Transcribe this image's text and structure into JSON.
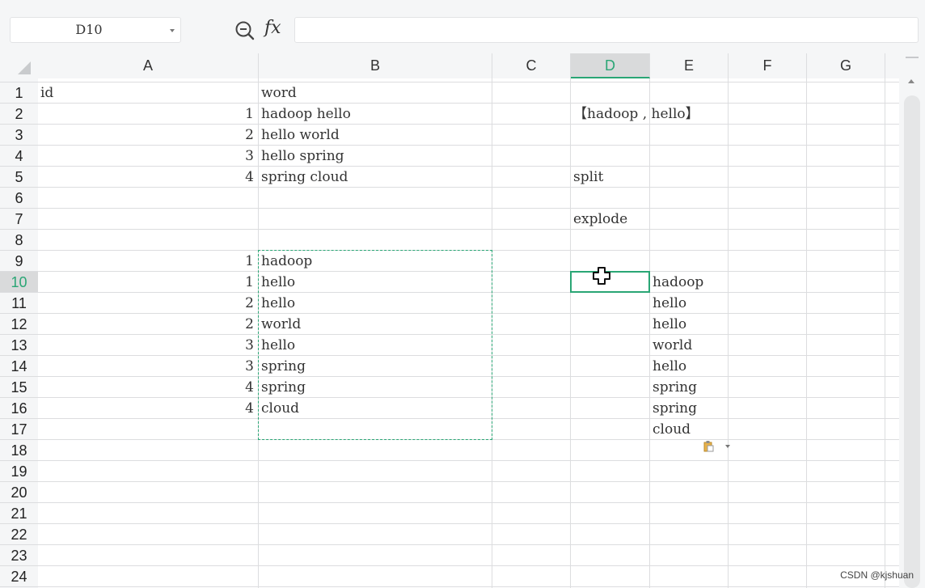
{
  "toolbar": {
    "name_box": "D10",
    "zoom_icon": "zoom-formula-icon",
    "fx_label": "fx",
    "formula_value": ""
  },
  "columns": [
    "A",
    "B",
    "C",
    "D",
    "E",
    "F",
    "G"
  ],
  "active_column": "D",
  "rows": [
    "1",
    "2",
    "3",
    "4",
    "5",
    "6",
    "7",
    "8",
    "9",
    "10",
    "11",
    "12",
    "13",
    "14",
    "15",
    "16",
    "17",
    "18",
    "19",
    "20",
    "21",
    "22",
    "23",
    "24"
  ],
  "active_row": "10",
  "cells": {
    "A1": "id",
    "B1": "word",
    "A2": "1",
    "B2": "hadoop hello",
    "A3": "2",
    "B3": "hello world",
    "A4": "3",
    "B4": "hello spring",
    "A5": "4",
    "B5": "spring cloud",
    "D2": "【hadoop , hello】",
    "D5": "split",
    "D7": "explode",
    "A9": "1",
    "B9": "hadoop",
    "A10": "1",
    "B10": "hello",
    "A11": "2",
    "B11": "hello",
    "A12": "2",
    "B12": "world",
    "A13": "3",
    "B13": "hello",
    "A14": "3",
    "B14": "spring",
    "A15": "4",
    "B15": "spring",
    "A16": "4",
    "B16": "cloud",
    "E10": "hadoop",
    "E11": "hello",
    "E12": "hello",
    "E13": "world",
    "E14": "hello",
    "E15": "spring",
    "E16": "spring",
    "E17": "cloud"
  },
  "copy_range": "B9:B17",
  "selected_cell": "D10",
  "colors": {
    "accent": "#2aa675",
    "header_bg": "#f5f6f7",
    "grid_line": "#dcdddf"
  },
  "watermark": "CSDN @kjshuan"
}
